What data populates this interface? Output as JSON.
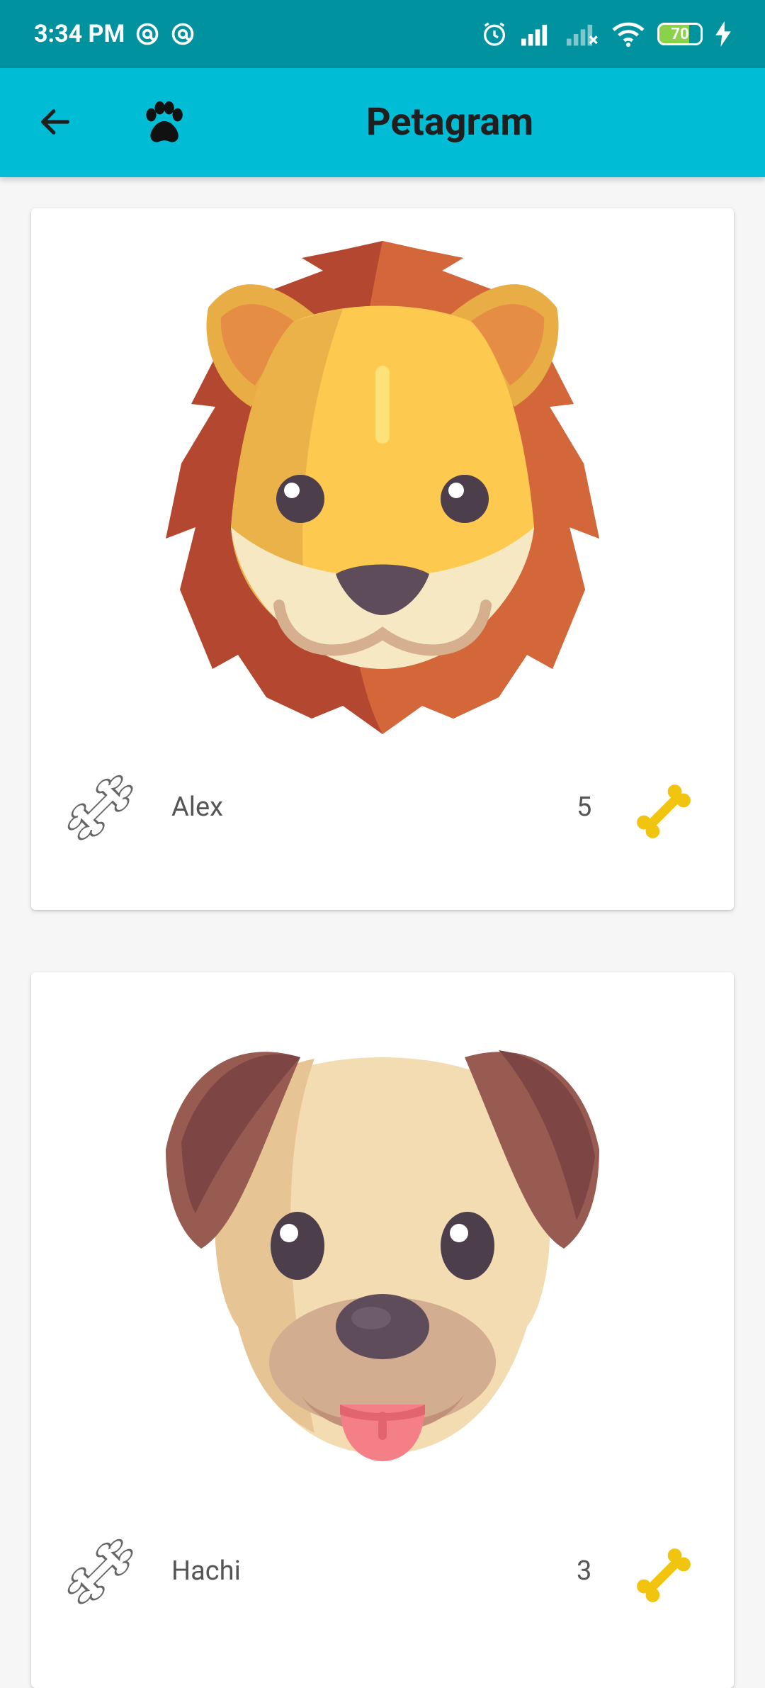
{
  "status_bar": {
    "time": "3:34 PM",
    "battery": "70"
  },
  "app_bar": {
    "title": "Petagram"
  },
  "pets": [
    {
      "name": "Alex",
      "likes": "5",
      "animal": "lion"
    },
    {
      "name": "Hachi",
      "likes": "3",
      "animal": "dog"
    }
  ],
  "colors": {
    "status_bar": "#00939f",
    "app_bar": "#00bcd4",
    "bone_accent": "#f1c40f"
  }
}
